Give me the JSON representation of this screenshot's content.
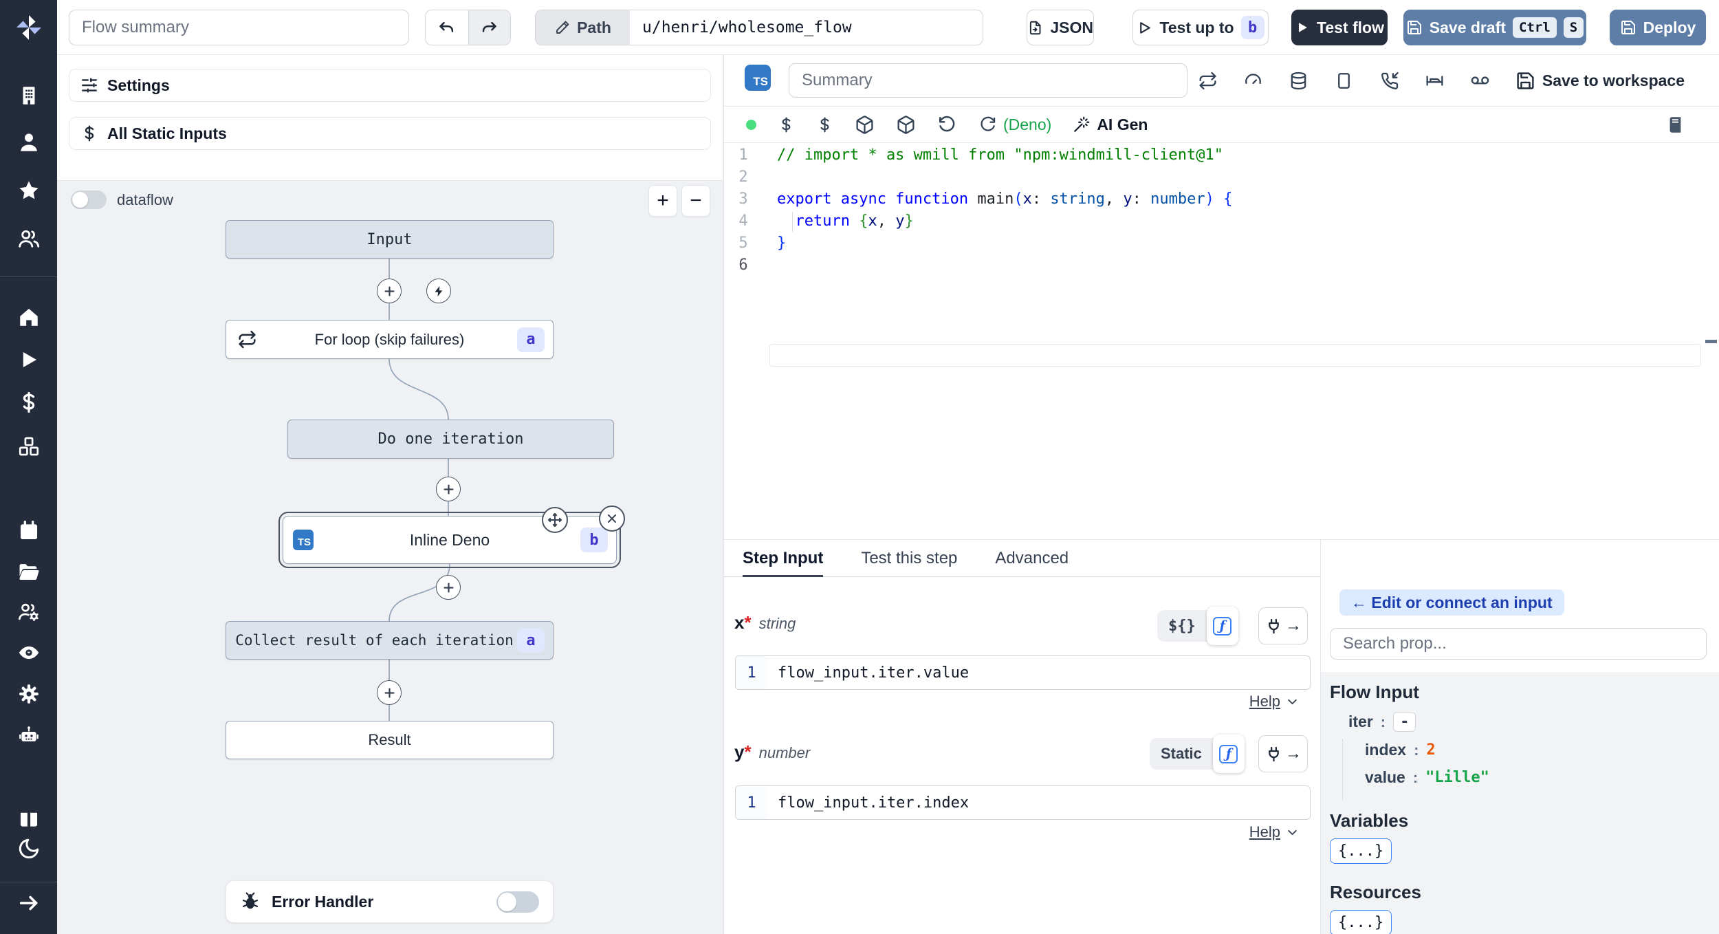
{
  "topbar": {
    "flow_summary_placeholder": "Flow summary",
    "path_label": "Path",
    "path_value": "u/henri/wholesome_flow",
    "json_label": "JSON",
    "test_up_to_label": "Test up to",
    "test_up_to_badge": "b",
    "test_flow_label": "Test flow",
    "save_draft_label": "Save draft",
    "kbd_ctrl": "Ctrl",
    "kbd_s": "S",
    "deploy_label": "Deploy"
  },
  "left_panel": {
    "settings_label": "Settings",
    "static_inputs_label": "All Static Inputs",
    "dataflow_label": "dataflow",
    "zoom_in_label": "+",
    "zoom_out_label": "−"
  },
  "graph": {
    "input_label": "Input",
    "for_loop_label": "For loop (skip failures)",
    "for_loop_badge": "a",
    "do_one_label": "Do one iteration",
    "inline_label": "Inline Deno",
    "inline_badge": "b",
    "inline_lang": "TS",
    "collect_label": "Collect result of each iteration",
    "collect_badge": "a",
    "result_label": "Result",
    "error_handler_label": "Error Handler"
  },
  "editor": {
    "lang_badge": "TS",
    "summary_placeholder": "Summary",
    "deno_label": "(Deno)",
    "ai_gen_label": "AI Gen",
    "save_to_workspace_label": "Save to workspace",
    "code": {
      "active_line": 6,
      "token_colors": {
        "comment": "#008000",
        "keyword": "#0000ff",
        "type": "#0451a5",
        "param": "#001080",
        "plain": "#1f2328",
        "bprimary": "#0431fa",
        "bgreen": "#319331"
      },
      "lines": [
        [
          {
            "t": "// import * as wmill from \"npm:windmill-client@1\"",
            "c": "comment"
          }
        ],
        [],
        [
          {
            "t": "export async function ",
            "c": "keyword"
          },
          {
            "t": "main",
            "c": "plain"
          },
          {
            "t": "(",
            "c": "bprimary"
          },
          {
            "t": "x",
            "c": "param"
          },
          {
            "t": ": ",
            "c": "plain"
          },
          {
            "t": "string",
            "c": "type"
          },
          {
            "t": ", ",
            "c": "plain"
          },
          {
            "t": "y",
            "c": "param"
          },
          {
            "t": ": ",
            "c": "plain"
          },
          {
            "t": "number",
            "c": "type"
          },
          {
            "t": ") {",
            "c": "bprimary"
          }
        ],
        [
          {
            "t": "  ",
            "c": "plain"
          },
          {
            "t": "return ",
            "c": "keyword"
          },
          {
            "t": "{",
            "c": "bgreen"
          },
          {
            "t": "x",
            "c": "param"
          },
          {
            "t": ", ",
            "c": "plain"
          },
          {
            "t": "y",
            "c": "param"
          },
          {
            "t": "}",
            "c": "bgreen"
          }
        ],
        [
          {
            "t": "}",
            "c": "bprimary"
          }
        ],
        []
      ]
    }
  },
  "bottom": {
    "tabs": [
      "Step Input",
      "Test this step",
      "Advanced"
    ],
    "active_tab": "Step Input",
    "function_glyph": "ƒ",
    "fields": [
      {
        "name": "x",
        "required": "*",
        "type": "string",
        "mode": "${}",
        "expr_line": "1",
        "expr": "flow_input.iter.value",
        "help": "Help"
      },
      {
        "name": "y",
        "required": "*",
        "type": "number",
        "mode": "Static",
        "expr_line": "1",
        "expr": "flow_input.iter.index",
        "help": "Help"
      }
    ]
  },
  "props": {
    "edit_chip": "← Edit or connect an input",
    "search_placeholder": "Search prop...",
    "flow_input_title": "Flow Input",
    "rows": [
      {
        "key": "iter",
        "value": "-",
        "boxed": true,
        "indent": 0
      },
      {
        "key": "index",
        "value": "2",
        "color": "#e8590c",
        "indent": 1
      },
      {
        "key": "value",
        "value": "\"Lille\"",
        "color": "#16a34a",
        "indent": 1
      }
    ],
    "variables_title": "Variables",
    "resources_title": "Resources",
    "object_chip": "{...}"
  },
  "colors": {
    "accent_blue": "#5e7ea7",
    "dark_navy": "#272e3d",
    "sidebar_bg": "#242b3a",
    "badge_bg": "#e0e7ff",
    "badge_text": "#4338ca",
    "ts_blue": "#3178c6",
    "deno_green": "#16a34a",
    "status_green": "#4ade80",
    "canvas_bg": "#eff1f4"
  },
  "icons": {
    "windmill-logo": "pinwheel",
    "building-icon": "building",
    "user-icon": "person",
    "star-icon": "★",
    "users-icon": "two people",
    "home-icon": "house",
    "play-icon": "▶",
    "dollar-icon": "$",
    "boxes-icon": "cubes",
    "calendar-icon": "calendar",
    "folder-open-icon": "open folder",
    "users-cog-icon": "people+gear",
    "eye-icon": "eye",
    "gear-icon": "⚙",
    "robot-icon": "robot",
    "book-open-icon": "books",
    "moon-icon": "☾",
    "arrow-right-icon": "→",
    "pencil-icon": "pencil",
    "undo-icon": "↶",
    "redo-icon": "↷",
    "file-json-icon": "file",
    "save-icon": "floppy",
    "sliders-icon": "sliders",
    "repeat-icon": "loop arrows",
    "bolt-icon": "⚡",
    "plus-icon": "+",
    "move-icon": "move arrows",
    "close-icon": "✕",
    "bug-icon": "bug",
    "gauge-icon": "gauge",
    "database-icon": "cylinder",
    "smartphone-icon": "rect",
    "phone-incoming-icon": "phone call in",
    "route-icon": "bench/route",
    "voicemail-icon": "oo",
    "book-icon": "book",
    "rotate-ccw-icon": "undo arc",
    "refresh-cw-icon": "refresh arc",
    "wand-icon": "magic wand",
    "function-icon": "ƒ",
    "plug-icon": "plug",
    "chevron-down-icon": "v"
  }
}
